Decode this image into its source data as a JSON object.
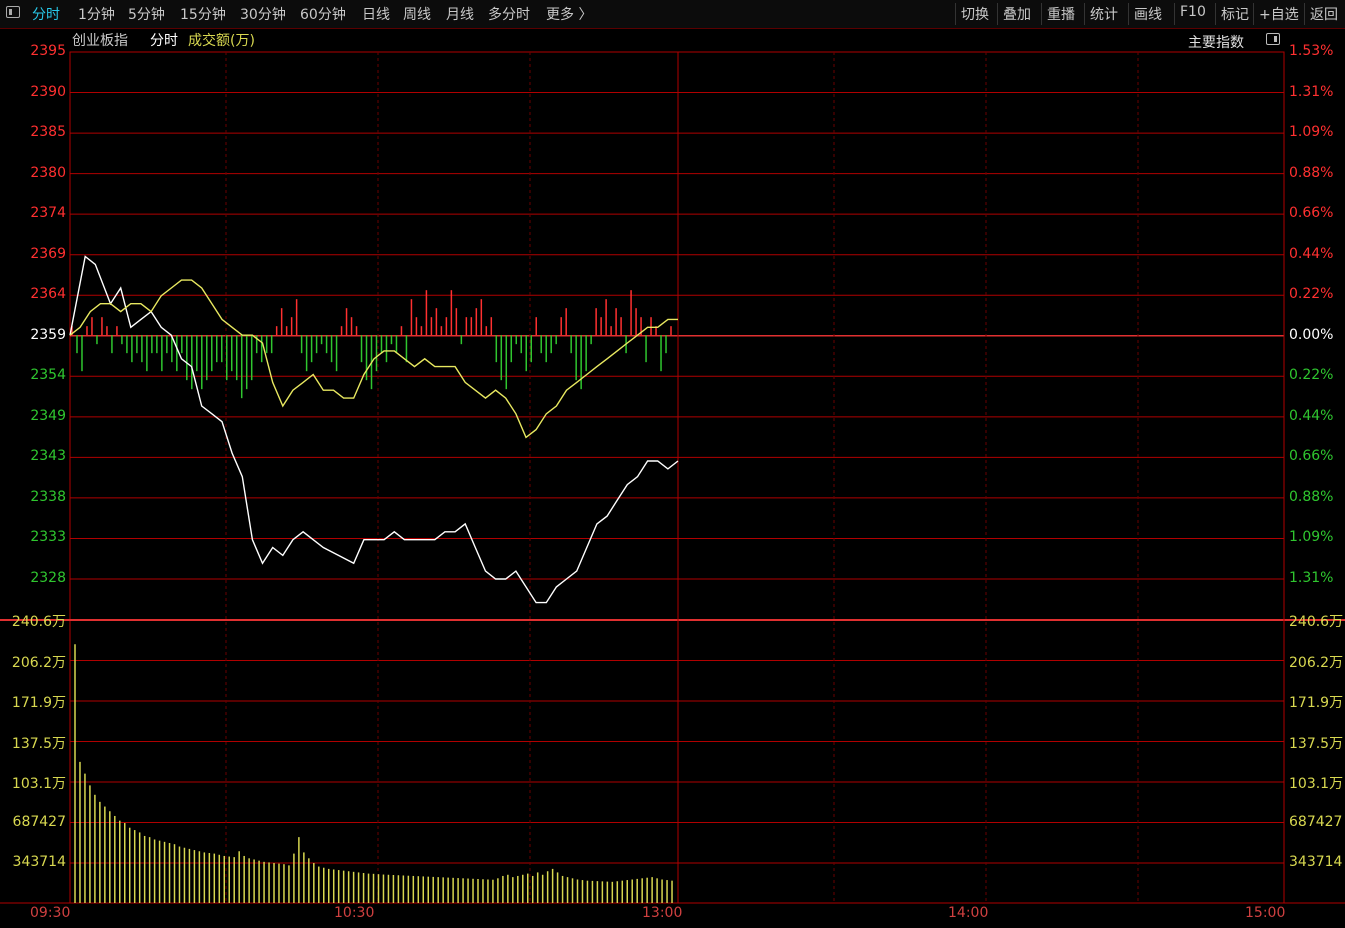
{
  "toolbar": {
    "left": [
      "分时",
      "1分钟",
      "5分钟",
      "15分钟",
      "30分钟",
      "60分钟",
      "日线",
      "周线",
      "月线",
      "多分时",
      "更多 〉"
    ],
    "right": [
      "切换",
      "叠加",
      "重播",
      "统计",
      "画线",
      "F10",
      "标记",
      "+自选",
      "返回"
    ],
    "active": "分时"
  },
  "header": {
    "index_name": "创业板指",
    "mode": "分时",
    "volume_label": "成交额(万)",
    "main_index_label": "主要指数"
  },
  "colors": {
    "up": "#ff3030",
    "down": "#2fc62f",
    "grid": "#b00000",
    "price_line": "#ffffff",
    "avg_line": "#e8e860",
    "volume_bar": "#d8d850"
  },
  "price_axis_left": [
    "2395",
    "2390",
    "2385",
    "2380",
    "2374",
    "2369",
    "2364",
    "2359",
    "2354",
    "2349",
    "2343",
    "2338",
    "2333",
    "2328"
  ],
  "price_axis_right": [
    "1.53%",
    "1.31%",
    "1.09%",
    "0.88%",
    "0.66%",
    "0.44%",
    "0.22%",
    "0.00%",
    "0.22%",
    "0.44%",
    "0.66%",
    "0.88%",
    "1.09%",
    "1.31%"
  ],
  "volume_axis": [
    "240.6万",
    "206.2万",
    "171.9万",
    "137.5万",
    "103.1万",
    "687427",
    "343714"
  ],
  "time_axis": [
    "09:30",
    "10:30",
    "13:00",
    "14:00",
    "15:00"
  ],
  "chart_data": {
    "type": "line",
    "title": "创业板指 分时",
    "reference_price": 2359,
    "ylim": [
      2328,
      2395
    ],
    "series": [
      {
        "name": "price",
        "x_minutes": [
          0,
          3,
          5,
          8,
          10,
          12,
          14,
          16,
          18,
          20,
          22,
          24,
          26,
          28,
          30,
          32,
          34,
          36,
          38,
          40,
          42,
          44,
          46,
          48,
          50,
          53,
          56,
          58,
          60,
          62,
          64,
          66,
          68,
          70,
          72,
          74,
          76,
          78,
          80,
          82,
          84,
          86,
          88,
          90,
          92,
          94,
          96,
          98,
          100,
          102,
          104,
          106,
          108,
          110,
          112,
          114,
          116,
          118,
          120
        ],
        "values": [
          2359,
          2369,
          2368,
          2363,
          2365,
          2360,
          2361,
          2362,
          2360,
          2359,
          2356,
          2355,
          2350,
          2349,
          2348,
          2344,
          2341,
          2333,
          2330,
          2332,
          2331,
          2333,
          2334,
          2333,
          2332,
          2331,
          2330,
          2333,
          2333,
          2333,
          2334,
          2333,
          2333,
          2333,
          2333,
          2334,
          2334,
          2335,
          2332,
          2329,
          2328,
          2328,
          2329,
          2327,
          2325,
          2325,
          2327,
          2328,
          2329,
          2332,
          2335,
          2336,
          2338,
          2340,
          2341,
          2343,
          2343,
          2342,
          2343
        ]
      },
      {
        "name": "average",
        "x_minutes": [
          0,
          2,
          4,
          6,
          8,
          10,
          12,
          14,
          16,
          18,
          20,
          22,
          24,
          26,
          28,
          30,
          32,
          34,
          36,
          38,
          40,
          42,
          44,
          46,
          48,
          50,
          52,
          54,
          56,
          58,
          60,
          62,
          64,
          66,
          68,
          70,
          72,
          74,
          76,
          78,
          80,
          82,
          84,
          86,
          88,
          90,
          92,
          94,
          96,
          98,
          100,
          102,
          104,
          106,
          108,
          110,
          112,
          114,
          116,
          118,
          120
        ],
        "values": [
          2359,
          2360,
          2362,
          2363,
          2363,
          2362,
          2363,
          2363,
          2362,
          2364,
          2365,
          2366,
          2366,
          2365,
          2363,
          2361,
          2360,
          2359,
          2359,
          2358,
          2353,
          2350,
          2352,
          2353,
          2354,
          2352,
          2352,
          2351,
          2351,
          2354,
          2356,
          2357,
          2357,
          2356,
          2355,
          2356,
          2355,
          2355,
          2355,
          2353,
          2352,
          2351,
          2352,
          2351,
          2349,
          2346,
          2347,
          2349,
          2350,
          2352,
          2353,
          2354,
          2355,
          2356,
          2357,
          2358,
          2359,
          2360,
          2360,
          2361,
          2361
        ]
      }
    ],
    "diff_bars": [
      1,
      -2,
      -4,
      1,
      2,
      -1,
      2,
      1,
      -2,
      1,
      -1,
      -2,
      -3,
      -2,
      -3,
      -4,
      -2,
      -2,
      -4,
      -2,
      -3,
      -4,
      -2,
      -5,
      -6,
      -4,
      -6,
      -5,
      -4,
      -3,
      -3,
      -5,
      -4,
      -5,
      -7,
      -6,
      -5,
      -2,
      -3,
      -2,
      -2,
      1,
      3,
      1,
      2,
      4,
      -2,
      -4,
      -3,
      -2,
      -1,
      -2,
      -3,
      -4,
      1,
      3,
      2,
      1,
      -3,
      -5,
      -6,
      -4,
      -2,
      -3,
      -1,
      -2,
      1,
      -3,
      4,
      2,
      1,
      5,
      2,
      3,
      1,
      2,
      5,
      3,
      -1,
      2,
      2,
      3,
      4,
      1,
      2,
      -3,
      -5,
      -6,
      -3,
      -1,
      -2,
      -4,
      -3,
      2,
      -2,
      -3,
      -2,
      -1,
      2,
      3,
      -2,
      -5,
      -6,
      -4,
      -1,
      3,
      2,
      4,
      1,
      3,
      2,
      -2,
      5,
      3,
      2,
      -3,
      2,
      1,
      -4,
      -2,
      1
    ]
  },
  "volume_chart": {
    "type": "bar",
    "ylim": [
      0,
      2406000
    ],
    "values": [
      2200000,
      1200000,
      1100000,
      1000000,
      920000,
      860000,
      820000,
      780000,
      740000,
      700000,
      680000,
      640000,
      620000,
      600000,
      570000,
      560000,
      540000,
      530000,
      520000,
      510000,
      500000,
      480000,
      470000,
      460000,
      450000,
      440000,
      430000,
      425000,
      420000,
      410000,
      400000,
      395000,
      390000,
      440000,
      400000,
      380000,
      370000,
      360000,
      350000,
      345000,
      340000,
      335000,
      330000,
      320000,
      420000,
      560000,
      430000,
      380000,
      340000,
      310000,
      300000,
      290000,
      285000,
      280000,
      275000,
      270000,
      265000,
      260000,
      255000,
      250000,
      248000,
      245000,
      242000,
      240000,
      238000,
      236000,
      234000,
      232000,
      230000,
      228000,
      226000,
      224000,
      222000,
      220000,
      218000,
      216000,
      214000,
      212000,
      210000,
      208000,
      206000,
      204000,
      202000,
      200000,
      198000,
      210000,
      230000,
      240000,
      220000,
      230000,
      240000,
      250000,
      230000,
      260000,
      240000,
      270000,
      290000,
      260000,
      230000,
      220000,
      210000,
      200000,
      195000,
      190000,
      188000,
      186000,
      184000,
      182000,
      180000,
      185000,
      190000,
      195000,
      200000,
      205000,
      210000,
      215000,
      220000,
      210000,
      200000,
      195000,
      190000
    ]
  }
}
